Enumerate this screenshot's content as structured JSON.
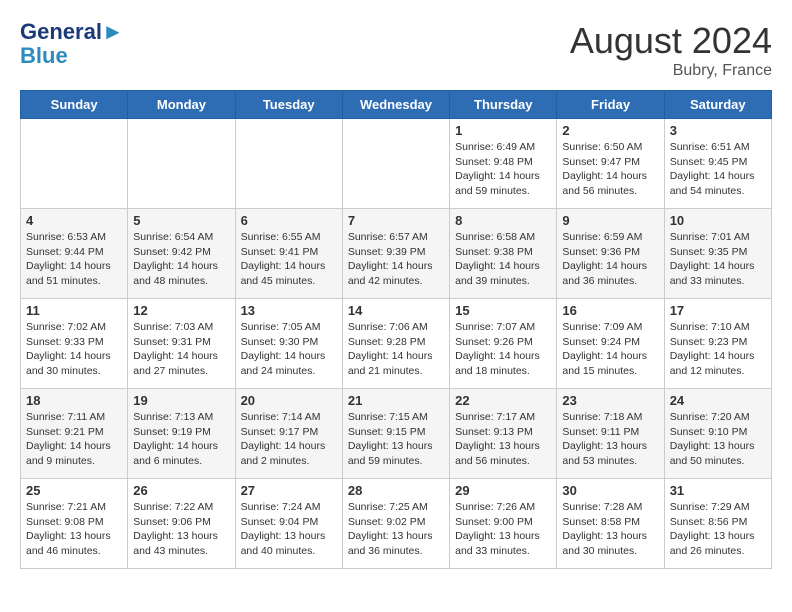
{
  "logo": {
    "line1": "General",
    "line2": "Blue"
  },
  "title": "August 2024",
  "location": "Bubry, France",
  "days_of_week": [
    "Sunday",
    "Monday",
    "Tuesday",
    "Wednesday",
    "Thursday",
    "Friday",
    "Saturday"
  ],
  "weeks": [
    [
      {
        "day": "",
        "details": ""
      },
      {
        "day": "",
        "details": ""
      },
      {
        "day": "",
        "details": ""
      },
      {
        "day": "",
        "details": ""
      },
      {
        "day": "1",
        "details": "Sunrise: 6:49 AM\nSunset: 9:48 PM\nDaylight: 14 hours\nand 59 minutes."
      },
      {
        "day": "2",
        "details": "Sunrise: 6:50 AM\nSunset: 9:47 PM\nDaylight: 14 hours\nand 56 minutes."
      },
      {
        "day": "3",
        "details": "Sunrise: 6:51 AM\nSunset: 9:45 PM\nDaylight: 14 hours\nand 54 minutes."
      }
    ],
    [
      {
        "day": "4",
        "details": "Sunrise: 6:53 AM\nSunset: 9:44 PM\nDaylight: 14 hours\nand 51 minutes."
      },
      {
        "day": "5",
        "details": "Sunrise: 6:54 AM\nSunset: 9:42 PM\nDaylight: 14 hours\nand 48 minutes."
      },
      {
        "day": "6",
        "details": "Sunrise: 6:55 AM\nSunset: 9:41 PM\nDaylight: 14 hours\nand 45 minutes."
      },
      {
        "day": "7",
        "details": "Sunrise: 6:57 AM\nSunset: 9:39 PM\nDaylight: 14 hours\nand 42 minutes."
      },
      {
        "day": "8",
        "details": "Sunrise: 6:58 AM\nSunset: 9:38 PM\nDaylight: 14 hours\nand 39 minutes."
      },
      {
        "day": "9",
        "details": "Sunrise: 6:59 AM\nSunset: 9:36 PM\nDaylight: 14 hours\nand 36 minutes."
      },
      {
        "day": "10",
        "details": "Sunrise: 7:01 AM\nSunset: 9:35 PM\nDaylight: 14 hours\nand 33 minutes."
      }
    ],
    [
      {
        "day": "11",
        "details": "Sunrise: 7:02 AM\nSunset: 9:33 PM\nDaylight: 14 hours\nand 30 minutes."
      },
      {
        "day": "12",
        "details": "Sunrise: 7:03 AM\nSunset: 9:31 PM\nDaylight: 14 hours\nand 27 minutes."
      },
      {
        "day": "13",
        "details": "Sunrise: 7:05 AM\nSunset: 9:30 PM\nDaylight: 14 hours\nand 24 minutes."
      },
      {
        "day": "14",
        "details": "Sunrise: 7:06 AM\nSunset: 9:28 PM\nDaylight: 14 hours\nand 21 minutes."
      },
      {
        "day": "15",
        "details": "Sunrise: 7:07 AM\nSunset: 9:26 PM\nDaylight: 14 hours\nand 18 minutes."
      },
      {
        "day": "16",
        "details": "Sunrise: 7:09 AM\nSunset: 9:24 PM\nDaylight: 14 hours\nand 15 minutes."
      },
      {
        "day": "17",
        "details": "Sunrise: 7:10 AM\nSunset: 9:23 PM\nDaylight: 14 hours\nand 12 minutes."
      }
    ],
    [
      {
        "day": "18",
        "details": "Sunrise: 7:11 AM\nSunset: 9:21 PM\nDaylight: 14 hours\nand 9 minutes."
      },
      {
        "day": "19",
        "details": "Sunrise: 7:13 AM\nSunset: 9:19 PM\nDaylight: 14 hours\nand 6 minutes."
      },
      {
        "day": "20",
        "details": "Sunrise: 7:14 AM\nSunset: 9:17 PM\nDaylight: 14 hours\nand 2 minutes."
      },
      {
        "day": "21",
        "details": "Sunrise: 7:15 AM\nSunset: 9:15 PM\nDaylight: 13 hours\nand 59 minutes."
      },
      {
        "day": "22",
        "details": "Sunrise: 7:17 AM\nSunset: 9:13 PM\nDaylight: 13 hours\nand 56 minutes."
      },
      {
        "day": "23",
        "details": "Sunrise: 7:18 AM\nSunset: 9:11 PM\nDaylight: 13 hours\nand 53 minutes."
      },
      {
        "day": "24",
        "details": "Sunrise: 7:20 AM\nSunset: 9:10 PM\nDaylight: 13 hours\nand 50 minutes."
      }
    ],
    [
      {
        "day": "25",
        "details": "Sunrise: 7:21 AM\nSunset: 9:08 PM\nDaylight: 13 hours\nand 46 minutes."
      },
      {
        "day": "26",
        "details": "Sunrise: 7:22 AM\nSunset: 9:06 PM\nDaylight: 13 hours\nand 43 minutes."
      },
      {
        "day": "27",
        "details": "Sunrise: 7:24 AM\nSunset: 9:04 PM\nDaylight: 13 hours\nand 40 minutes."
      },
      {
        "day": "28",
        "details": "Sunrise: 7:25 AM\nSunset: 9:02 PM\nDaylight: 13 hours\nand 36 minutes."
      },
      {
        "day": "29",
        "details": "Sunrise: 7:26 AM\nSunset: 9:00 PM\nDaylight: 13 hours\nand 33 minutes."
      },
      {
        "day": "30",
        "details": "Sunrise: 7:28 AM\nSunset: 8:58 PM\nDaylight: 13 hours\nand 30 minutes."
      },
      {
        "day": "31",
        "details": "Sunrise: 7:29 AM\nSunset: 8:56 PM\nDaylight: 13 hours\nand 26 minutes."
      }
    ]
  ]
}
